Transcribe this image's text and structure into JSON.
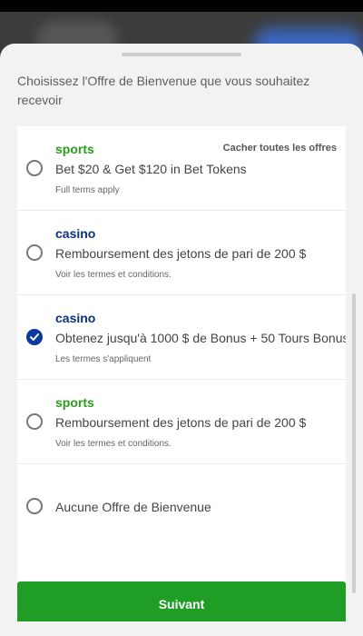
{
  "sheet": {
    "intro": "Choisissez l'Offre de Bienvenue que vous souhaitez recevoir",
    "hide_all_label": "Cacher toutes les offres",
    "offers": [
      {
        "category": "sports",
        "title": "Bet $20 & Get $120 in Bet Tokens",
        "terms": "Full terms apply",
        "selected": false
      },
      {
        "category": "casino",
        "title": "Remboursement des jetons de pari de 200 $",
        "terms": "Voir les termes et conditions.",
        "selected": false
      },
      {
        "category": "casino",
        "title": "Obtenez jusqu'à 1000 $ de Bonus + 50 Tours Bonus",
        "terms": "Les termes s'appliquent",
        "selected": true
      },
      {
        "category": "sports",
        "title": "Remboursement des jetons de pari de 200 $",
        "terms": "Voir les termes et conditions.",
        "selected": false
      }
    ],
    "no_offer_label": "Aucune Offre de Bienvenue",
    "next_label": "Suivant"
  },
  "colors": {
    "sports": "#2a9d1c",
    "casino": "#0b2f86",
    "button": "#1f9d24",
    "radio_checked": "#0b3aa0"
  },
  "icons": {
    "selected_radio": "check-icon"
  }
}
